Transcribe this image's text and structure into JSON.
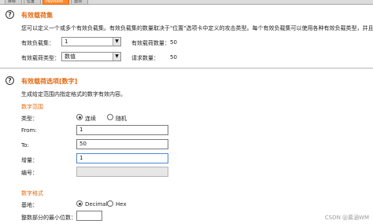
{
  "tabs": [
    "目标",
    "位置",
    "Payloads",
    "选项"
  ],
  "payload_sets": {
    "title": "有效载荷集",
    "description": "您可以定义一个或多个有效负载集。有效负载集的数量取决于\"位置\"选项卡中定义的攻击类型。每个有效负载集可以使用各种有效负载类型，并且可以",
    "set_label": "有效负载集：",
    "set_value": "1",
    "count_label": "有效载荷数量：",
    "count_value": "50",
    "type_label": "有效载荷类型：",
    "type_value": "数值",
    "request_label": "请求数量：",
    "request_value": "50"
  },
  "payload_options": {
    "title": "有效载荷选项[数字]",
    "description": "生成给定范围内指定格式的数字有效内容。",
    "range_title": "数字范围",
    "type_label": "类型：",
    "type_sequential": "连续",
    "type_random": "随机",
    "from_label": "From:",
    "from_value": "1",
    "to_label": "To:",
    "to_value": "50",
    "step_label": "增量：",
    "step_value": "1",
    "how_many_label": "编号：",
    "format_title": "数字格式",
    "base_label": "基地：",
    "base_decimal": "Decimal",
    "base_hex": "Hex",
    "min_int_label": "整数部分的最小位数："
  },
  "watermark": "CSDN @慕涵WM",
  "colors": {
    "accent": "#e46a12",
    "tab_active": "#ff8a2b"
  },
  "icons": {
    "help": "question-circle-icon",
    "dropdown": "chevron-down-icon"
  }
}
